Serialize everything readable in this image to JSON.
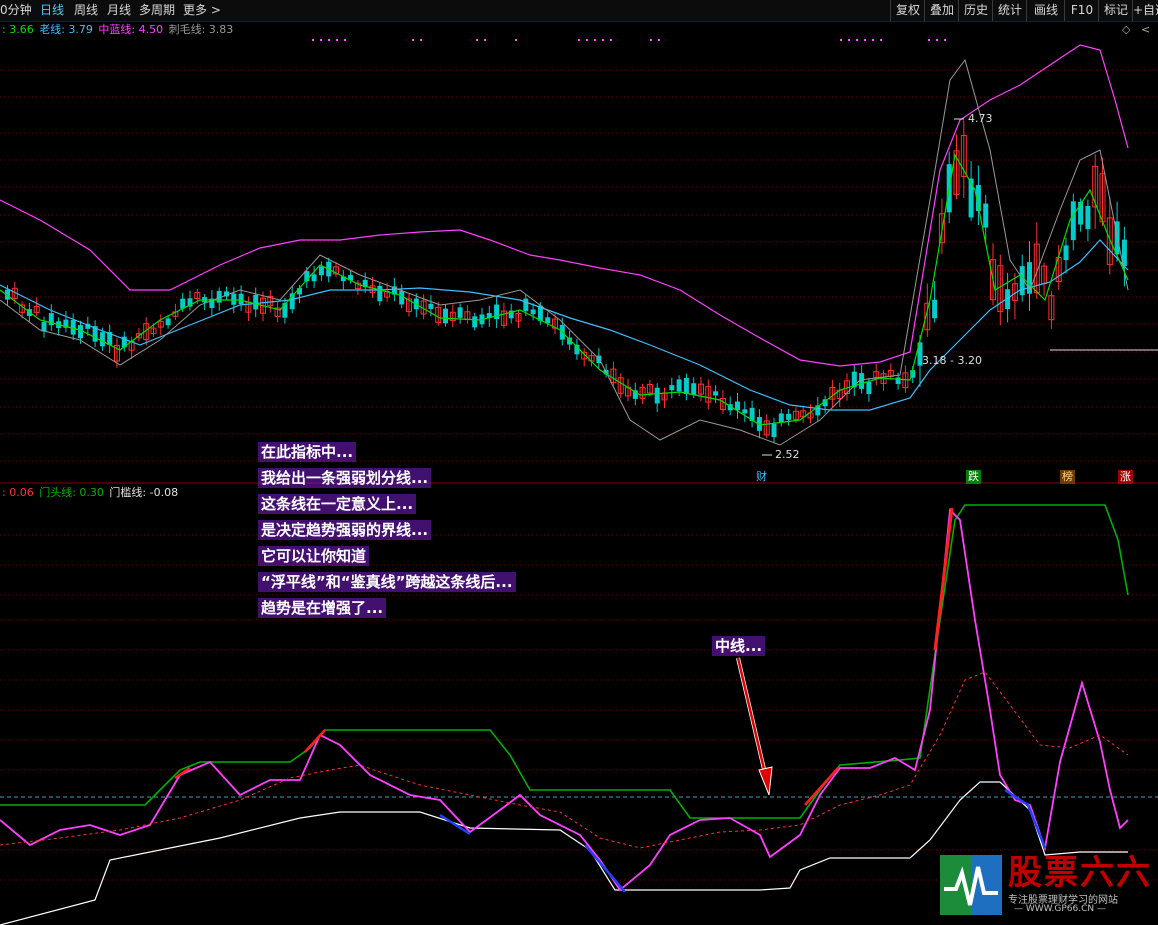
{
  "toolbar": {
    "left_items": [
      "0分钟",
      "日线",
      "周线",
      "月线",
      "多周期",
      "更多 >"
    ],
    "active_index": 1,
    "right_items": [
      "复权",
      "叠加",
      "历史",
      "统计",
      "画线",
      "F10",
      "标记",
      "+自选"
    ]
  },
  "legend_top": {
    "items": [
      {
        "label": ": 3.66",
        "color": "#00e000"
      },
      {
        "label": "老线: 3.79",
        "color": "#3fbfff"
      },
      {
        "label": "中蓝线: 4.50",
        "color": "#ff40ff"
      },
      {
        "label": "刺毛线: 3.83",
        "color": "#999999"
      }
    ],
    "diamond": "◇",
    "arrow": "<"
  },
  "legend_bottom": {
    "items": [
      {
        "label": ": 0.06",
        "color": "#ff3030"
      },
      {
        "label": "门头线: 0.30",
        "color": "#00b000"
      },
      {
        "label": "门槛线: -0.08",
        "color": "#e0e0e0"
      }
    ]
  },
  "price_labels": {
    "high": "4.73",
    "low": "2.52",
    "range": "3.18 - 3.20"
  },
  "event_markers": [
    {
      "text": "财",
      "color": "#3fbfff"
    },
    {
      "text": "跌",
      "color": "#ffffff",
      "bg": "#008000"
    },
    {
      "text": "榜",
      "color": "#ffd080",
      "bg": "#6b3b00"
    },
    {
      "text": "涨",
      "color": "#ffffff",
      "bg": "#a00000"
    }
  ],
  "annotations": {
    "main_note": [
      "在此指标中...",
      "我给出一条强弱划分线...",
      "这条线在一定意义上...",
      "是决定趋势强弱的界线...",
      "它可以让你知道",
      "“浮平线”和“鉴真线”跨越这条线后...",
      "趋势是在增强了..."
    ],
    "mid_note": "中线..."
  },
  "watermark": {
    "title": "股票六六",
    "slogan": "专注股票理财学习的网站",
    "url": "— WWW.GP66.CN —"
  },
  "colors": {
    "up": "#ff3030",
    "down": "#00cccc",
    "fast_line": "#00e000",
    "slow_line": "#3fbfff",
    "envelope": "#ff40ff",
    "gray_line": "#999999",
    "grid": "#6a0000"
  },
  "chart_data": [
    {
      "type": "candlestick",
      "title": "",
      "series": [
        {
          "name": "老线",
          "value": 3.79
        },
        {
          "name": "中蓝线",
          "value": 4.5
        },
        {
          "name": "刺毛线",
          "value": 3.83
        }
      ],
      "annotations": [
        "4.73",
        "2.52",
        "3.18 - 3.20"
      ],
      "high": 4.73,
      "low": 2.52
    },
    {
      "type": "line",
      "series": [
        {
          "name": "门头线",
          "value": 0.3
        },
        {
          "name": "门槛线",
          "value": -0.08
        }
      ]
    }
  ]
}
